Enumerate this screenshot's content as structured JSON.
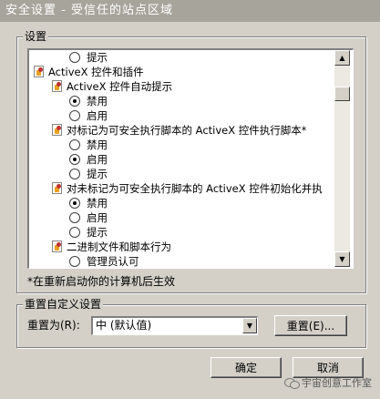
{
  "window": {
    "title": "安全设置 - 受信任的站点区域"
  },
  "settings_group": {
    "label": "设置"
  },
  "list": {
    "items": [
      {
        "type": "radio",
        "label": "提示",
        "checked": false
      },
      {
        "type": "group",
        "label": "ActiveX 控件和插件"
      },
      {
        "type": "setting",
        "label": "ActiveX 控件自动提示"
      },
      {
        "type": "radio",
        "label": "禁用",
        "checked": true
      },
      {
        "type": "radio",
        "label": "启用",
        "checked": false
      },
      {
        "type": "setting",
        "label": "对标记为可安全执行脚本的 ActiveX 控件执行脚本*"
      },
      {
        "type": "radio",
        "label": "禁用",
        "checked": false
      },
      {
        "type": "radio",
        "label": "启用",
        "checked": true
      },
      {
        "type": "radio",
        "label": "提示",
        "checked": false
      },
      {
        "type": "setting",
        "label": "对未标记为可安全执行脚本的 ActiveX 控件初始化并执"
      },
      {
        "type": "radio",
        "label": "禁用",
        "checked": true
      },
      {
        "type": "radio",
        "label": "启用",
        "checked": false
      },
      {
        "type": "radio",
        "label": "提示",
        "checked": false
      },
      {
        "type": "group",
        "label": "二进制文件和脚本行为"
      },
      {
        "type": "radio",
        "label": "管理员认可",
        "checked": false
      }
    ]
  },
  "restart_note": "*在重新启动你的计算机后生效",
  "reset_group": {
    "label": "重置自定义设置",
    "reset_to_label": "重置为(R):",
    "selected_value": "中 (默认值)",
    "reset_button": "重置(E)..."
  },
  "footer": {
    "ok_button": "确定",
    "cancel_button": "取消"
  },
  "watermark": {
    "text": "宇宙创意工作室"
  },
  "icons": {
    "radio": "radio-button",
    "group": "settings-gear-icon",
    "scroll_up": "scroll-up-arrow-icon",
    "scroll_down": "scroll-down-arrow-icon",
    "combo_arrow": "chevron-down-icon"
  },
  "colors": {
    "dialog_bg": "#d4d0c8",
    "title_bar_inactive": "#a7a49b",
    "list_bg": "#ffffff"
  }
}
